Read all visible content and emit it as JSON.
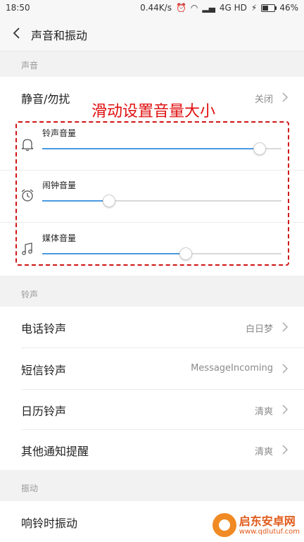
{
  "status_bar": {
    "time": "18:50",
    "speed": "0.44K/s",
    "network": "4G HD",
    "battery": "46%",
    "battery_level": 0.46
  },
  "header": {
    "title": "声音和振动"
  },
  "sections": {
    "sound": "声音",
    "ringtone": "铃声",
    "vibration": "振动"
  },
  "dnd": {
    "label": "静音/勿扰",
    "value": "关闭"
  },
  "sliders": [
    {
      "label": "铃声音量",
      "icon": "bell-icon",
      "level": 0.91
    },
    {
      "label": "闹钟音量",
      "icon": "alarm-clock-icon",
      "level": 0.28
    },
    {
      "label": "媒体音量",
      "icon": "music-note-icon",
      "level": 0.6
    }
  ],
  "ringtones": [
    {
      "label": "电话铃声",
      "value": "白日梦"
    },
    {
      "label": "短信铃声",
      "value": "MessageIncoming"
    },
    {
      "label": "日历铃声",
      "value": "清爽"
    },
    {
      "label": "其他通知提醒",
      "value": "清爽"
    }
  ],
  "vibration_row": {
    "label": "响铃时振动"
  },
  "annotation": {
    "text": "滑动设置音量大小",
    "color": "#d01515"
  },
  "colors": {
    "accent": "#4a9ae0",
    "watermark": "#e05a1a"
  },
  "watermark": {
    "title": "启东安卓网",
    "url": "www.qdlutuf.com"
  }
}
